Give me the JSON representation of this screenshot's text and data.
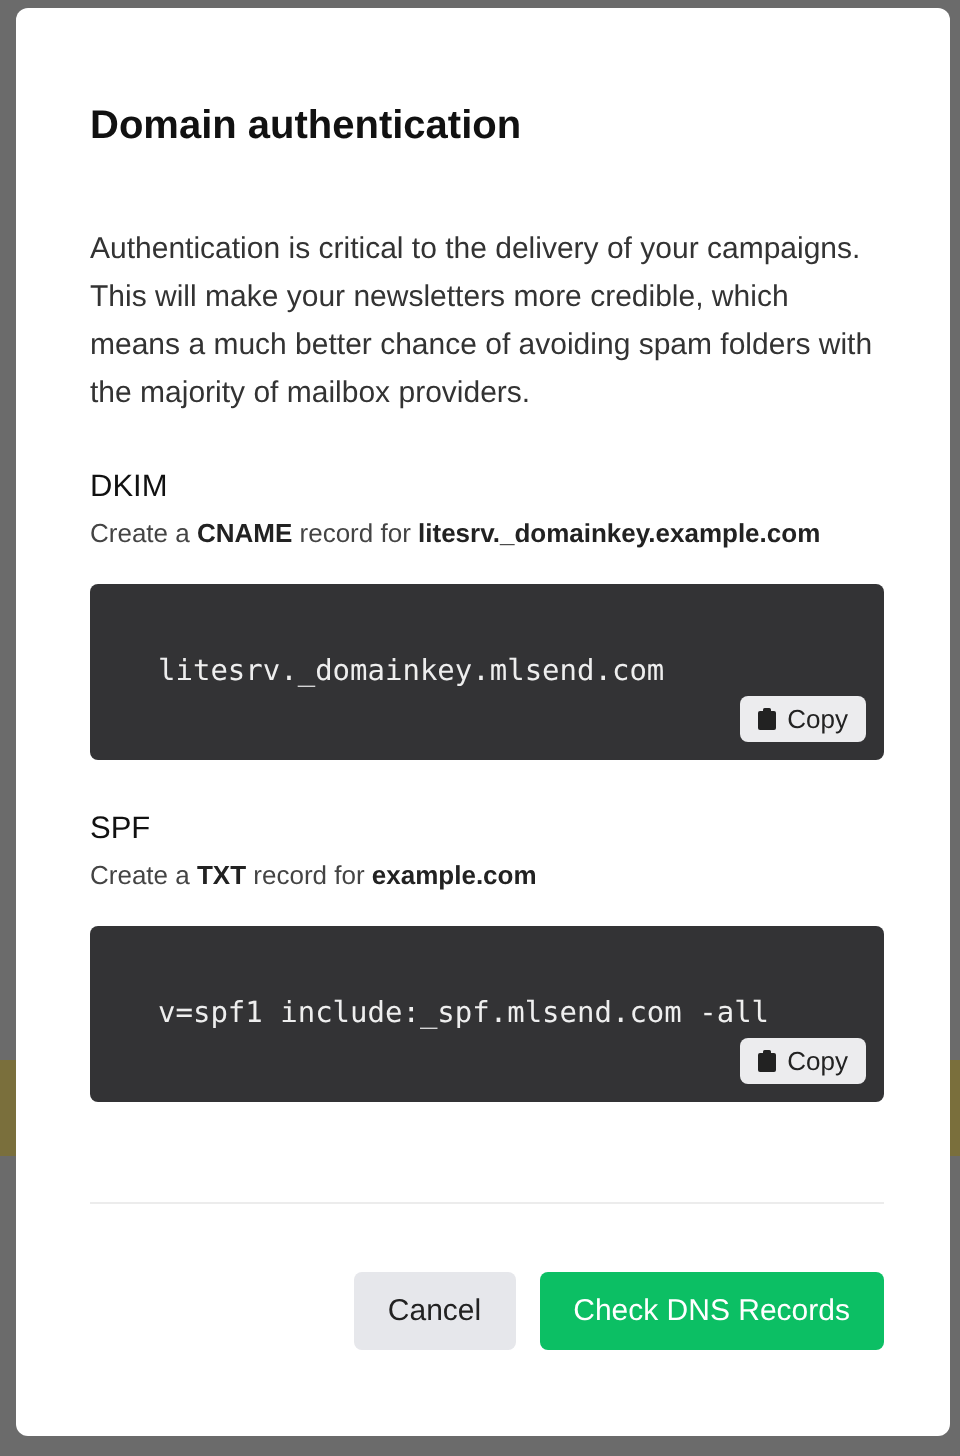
{
  "dialog": {
    "title": "Domain authentication",
    "description": "Authentication is critical to the delivery of your campaigns. This will make your newsletters more credible, which means a much better chance of avoiding spam folders with the majority of mailbox providers.",
    "records": [
      {
        "name": "DKIM",
        "instruction": "Create a **CNAME** record for **litesrv._domainkey.example.com**",
        "value": "litesrv._domainkey.mlsend.com",
        "copy_label": "Copy"
      },
      {
        "name": "SPF",
        "instruction": "Create a **TXT** record for **example.com**",
        "value": "v=spf1 include:_spf.mlsend.com -all",
        "copy_label": "Copy"
      }
    ],
    "buttons": [
      {
        "label": "Cancel",
        "kind": "secondary"
      },
      {
        "label": "Check DNS Records",
        "kind": "primary"
      }
    ]
  }
}
